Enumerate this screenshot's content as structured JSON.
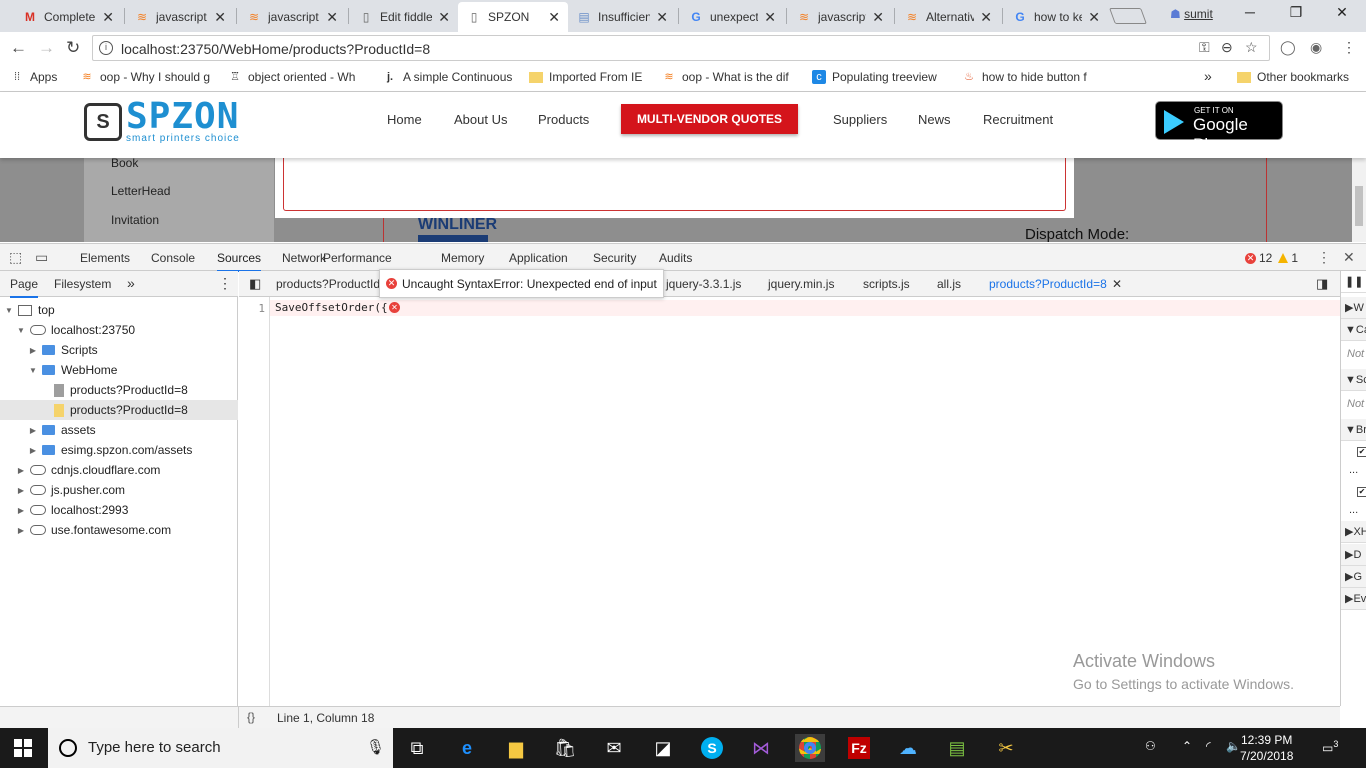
{
  "browser": {
    "tabs": [
      {
        "label": "Complete",
        "icon": "gmail-icon",
        "active": false
      },
      {
        "label": "javascript",
        "icon": "stackoverflow-icon",
        "active": false
      },
      {
        "label": "javascript",
        "icon": "stackoverflow-icon",
        "active": false
      },
      {
        "label": "Edit fiddle",
        "icon": "page-icon",
        "active": false
      },
      {
        "label": "SPZON",
        "icon": "page-icon",
        "active": true
      },
      {
        "label": "Insufficient",
        "icon": "doc-icon",
        "active": false
      },
      {
        "label": "unexpected",
        "icon": "google-icon",
        "active": false
      },
      {
        "label": "javascript",
        "icon": "stackoverflow-icon",
        "active": false
      },
      {
        "label": "Alternative",
        "icon": "stackoverflow-icon",
        "active": false
      },
      {
        "label": "how to ke",
        "icon": "google-icon",
        "active": false
      }
    ],
    "profile": "sumit",
    "url": "localhost:23750/WebHome/products?ProductId=8",
    "bookmarks": [
      {
        "label": "Apps",
        "icon": "apps-grid-icon"
      },
      {
        "label": "oop - Why I should g",
        "icon": "stackoverflow-icon"
      },
      {
        "label": "object oriented - Wh",
        "icon": "se-icon"
      },
      {
        "label": "A simple Continuous",
        "icon": "j-icon"
      },
      {
        "label": "Imported From IE",
        "icon": "folder-icon"
      },
      {
        "label": "oop - What is the dif",
        "icon": "stackoverflow-icon"
      },
      {
        "label": "Populating treeview",
        "icon": "c-icon"
      },
      {
        "label": "how to hide button f",
        "icon": "bottle-icon"
      },
      {
        "label": "Other bookmarks",
        "icon": "folder-icon"
      }
    ],
    "bookmarks_more": "»"
  },
  "site": {
    "logo_word": "SPZON",
    "logo_tagline": "smart printers choice",
    "nav": [
      "Home",
      "About Us",
      "Products",
      "Suppliers",
      "News",
      "Recruitment"
    ],
    "cta": "MULTI-VENDOR QUOTES",
    "gplay_small": "GET IT ON",
    "gplay_big": "Google Play",
    "side_links": [
      "Book",
      "LetterHead",
      "Invitation"
    ],
    "brand_logo": "WINLINER",
    "dispatch_label": "Dispatch Mode:"
  },
  "devtools": {
    "tabs": [
      "Elements",
      "Console",
      "Sources",
      "Network",
      "Performance",
      "Memory",
      "Application",
      "Security",
      "Audits"
    ],
    "active_tab": "Sources",
    "error_count": "12",
    "warning_count": "1",
    "navigator_tabs": [
      "Page",
      "Filesystem"
    ],
    "navigator_more": "»",
    "tree": [
      {
        "label": "top",
        "depth": 0,
        "kind": "frame",
        "open": true
      },
      {
        "label": "localhost:23750",
        "depth": 1,
        "kind": "cloud",
        "open": true
      },
      {
        "label": "Scripts",
        "depth": 2,
        "kind": "folder",
        "open": false
      },
      {
        "label": "WebHome",
        "depth": 2,
        "kind": "folder",
        "open": true
      },
      {
        "label": "products?ProductId=8",
        "depth": 3,
        "kind": "file",
        "open": null
      },
      {
        "label": "products?ProductId=8",
        "depth": 3,
        "kind": "file-yellow",
        "open": null,
        "selected": true
      },
      {
        "label": "assets",
        "depth": 2,
        "kind": "folder",
        "open": false
      },
      {
        "label": "esimg.spzon.com/assets",
        "depth": 2,
        "kind": "folder",
        "open": false
      },
      {
        "label": "cdnjs.cloudflare.com",
        "depth": 1,
        "kind": "cloud",
        "open": false
      },
      {
        "label": "js.pusher.com",
        "depth": 1,
        "kind": "cloud",
        "open": false
      },
      {
        "label": "localhost:2993",
        "depth": 1,
        "kind": "cloud",
        "open": false
      },
      {
        "label": "use.fontawesome.com",
        "depth": 1,
        "kind": "cloud",
        "open": false
      }
    ],
    "editor_tabs": [
      "products?ProductId",
      "jquery-3.3.1.js",
      "jquery.min.js",
      "scripts.js",
      "all.js",
      "products?ProductId=8"
    ],
    "error_tooltip": "Uncaught SyntaxError: Unexpected end of input",
    "code_line_number": "1",
    "code_text": "SaveOffsetOrder({",
    "status_braces": "{}",
    "status_position": "Line 1, Column 18",
    "sidebar_rows": [
      "W",
      "Ca",
      "Sc",
      "Br",
      "XH",
      "D",
      "G",
      "Ev"
    ],
    "sidebar_notes": [
      "Not",
      "Not"
    ],
    "sidebar_ellipsis": "..."
  },
  "watermark": {
    "line1": "Activate Windows",
    "line2": "Go to Settings to activate Windows."
  },
  "taskbar": {
    "search_placeholder": "Type here to search",
    "time": "12:39 PM",
    "date": "7/20/2018",
    "notification_count": "3"
  }
}
